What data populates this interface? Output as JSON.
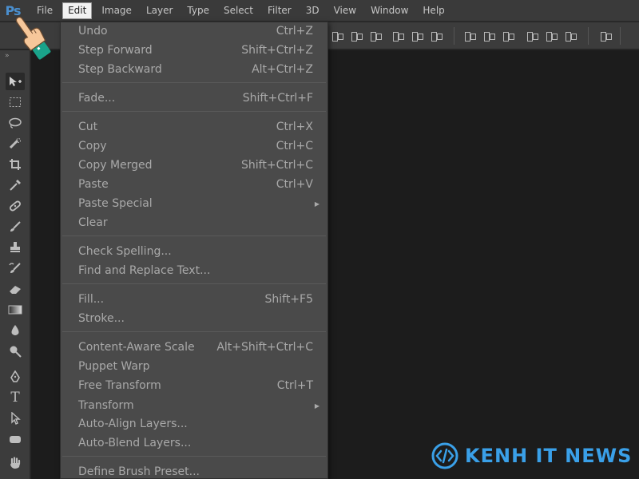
{
  "app": {
    "logo": "Ps"
  },
  "menubar": {
    "items": [
      "File",
      "Edit",
      "Image",
      "Layer",
      "Type",
      "Select",
      "Filter",
      "3D",
      "View",
      "Window",
      "Help"
    ],
    "active": "Edit"
  },
  "edit_menu": {
    "undo": {
      "label": "Undo",
      "shortcut": "Ctrl+Z"
    },
    "step_forward": {
      "label": "Step Forward",
      "shortcut": "Shift+Ctrl+Z"
    },
    "step_backward": {
      "label": "Step Backward",
      "shortcut": "Alt+Ctrl+Z"
    },
    "fade": {
      "label": "Fade...",
      "shortcut": "Shift+Ctrl+F"
    },
    "cut": {
      "label": "Cut",
      "shortcut": "Ctrl+X"
    },
    "copy": {
      "label": "Copy",
      "shortcut": "Ctrl+C"
    },
    "copy_merged": {
      "label": "Copy Merged",
      "shortcut": "Shift+Ctrl+C"
    },
    "paste": {
      "label": "Paste",
      "shortcut": "Ctrl+V"
    },
    "paste_special": {
      "label": "Paste Special"
    },
    "clear": {
      "label": "Clear"
    },
    "check_spelling": {
      "label": "Check Spelling..."
    },
    "find_replace": {
      "label": "Find and Replace Text..."
    },
    "fill": {
      "label": "Fill...",
      "shortcut": "Shift+F5"
    },
    "stroke": {
      "label": "Stroke..."
    },
    "content_aware_scale": {
      "label": "Content-Aware Scale",
      "shortcut": "Alt+Shift+Ctrl+C"
    },
    "puppet_warp": {
      "label": "Puppet Warp"
    },
    "free_transform": {
      "label": "Free Transform",
      "shortcut": "Ctrl+T"
    },
    "transform": {
      "label": "Transform"
    },
    "auto_align": {
      "label": "Auto-Align Layers..."
    },
    "auto_blend": {
      "label": "Auto-Blend Layers..."
    },
    "define_brush": {
      "label": "Define Brush Preset..."
    }
  },
  "watermark": {
    "text": "KENH IT NEWS",
    "color": "#3aa0e8"
  },
  "colors": {
    "menubar_bg": "#3a3a3a",
    "dropdown_bg": "#4a4a4a",
    "canvas_bg": "#1c1c1c",
    "logo_blue": "#4a8fcf"
  }
}
